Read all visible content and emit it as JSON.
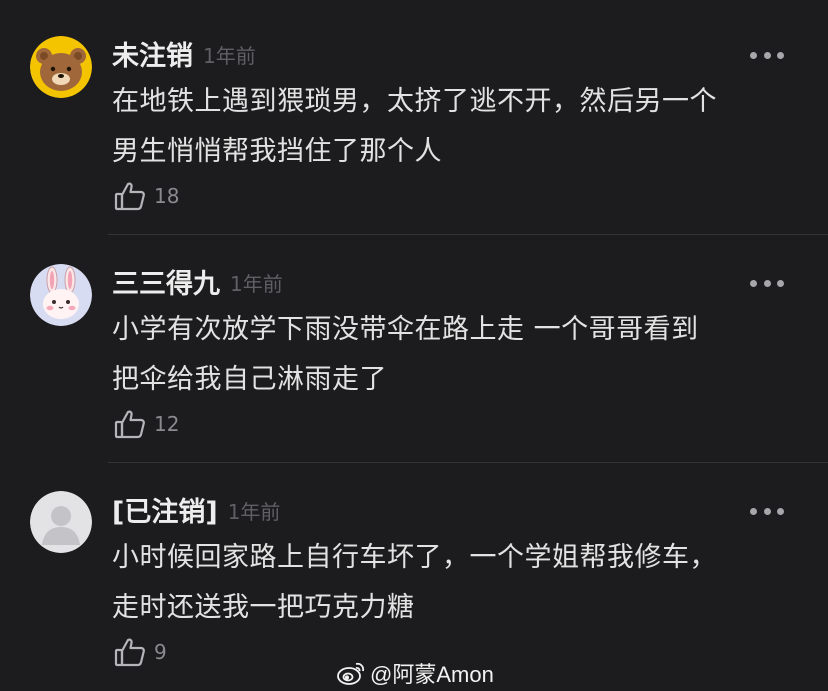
{
  "comments": [
    {
      "username": "未注销",
      "time": "1年前",
      "text_line1": "在地铁上遇到猥琐男，太挤了逃不开，然后另一个",
      "text_line2": "男生悄悄帮我挡住了那个人",
      "likes": "18",
      "avatar": "bear-avatar"
    },
    {
      "username": "三三得九",
      "time": "1年前",
      "text_line1": "小学有次放学下雨没带伞在路上走 一个哥哥看到",
      "text_line2": "把伞给我自己淋雨走了",
      "likes": "12",
      "avatar": "bunny-avatar"
    },
    {
      "username": "[已注销]",
      "time": "1年前",
      "text_line1": "小时候回家路上自行车坏了，一个学姐帮我修车，",
      "text_line2": "走时还送我一把巧克力糖",
      "likes": "9",
      "avatar": "default-avatar"
    }
  ],
  "watermark": {
    "text": "@阿蒙Amon",
    "icon": "weibo-icon"
  },
  "colors": {
    "background": "#1c1c1e",
    "primary_text": "#e2e2e2",
    "secondary_text": "#5f5f64",
    "divider": "#333336"
  }
}
